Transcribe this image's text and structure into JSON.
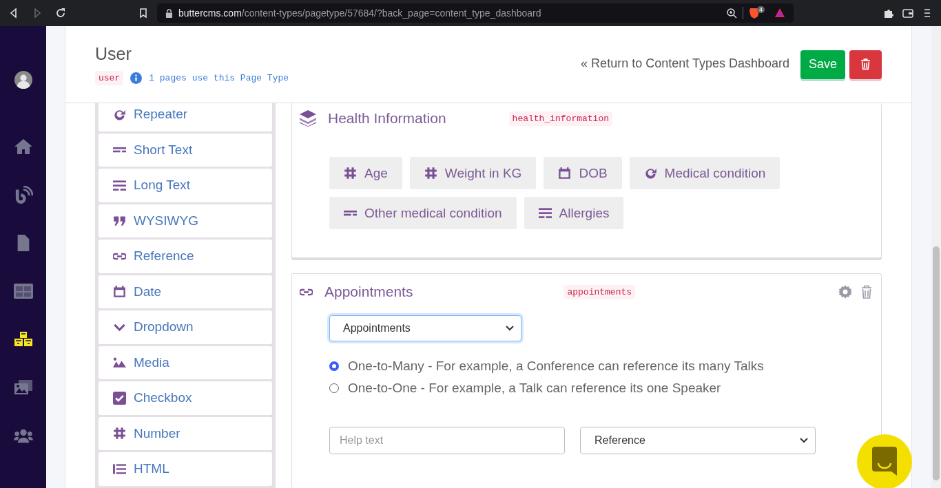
{
  "browser": {
    "url_host": "buttercms.com",
    "url_path": "/content-types/pagetype/57684/?back_page=content_type_dashboard",
    "shield_count": "4",
    "forward_disabled": true
  },
  "nav": {
    "items": [
      {
        "kind": "avatar",
        "selected": false
      },
      {
        "kind": "home",
        "selected": false
      },
      {
        "kind": "blog",
        "selected": false
      },
      {
        "kind": "pages",
        "selected": false
      },
      {
        "kind": "collections",
        "selected": false
      },
      {
        "kind": "content_types",
        "selected": true
      },
      {
        "kind": "media",
        "selected": false
      },
      {
        "kind": "users",
        "selected": false
      }
    ]
  },
  "header": {
    "title": "User",
    "slug": "user",
    "usage": "1 pages use this Page Type",
    "return_link": "« Return to Content Types Dashboard",
    "save": "Save"
  },
  "palette": [
    {
      "kind": "repeater",
      "label": "Repeater"
    },
    {
      "kind": "short_text",
      "label": "Short Text"
    },
    {
      "kind": "long_text",
      "label": "Long Text"
    },
    {
      "kind": "wysiwyg",
      "label": "WYSIWYG"
    },
    {
      "kind": "reference",
      "label": "Reference"
    },
    {
      "kind": "date",
      "label": "Date"
    },
    {
      "kind": "dropdown",
      "label": "Dropdown"
    },
    {
      "kind": "media",
      "label": "Media"
    },
    {
      "kind": "checkbox",
      "label": "Checkbox"
    },
    {
      "kind": "number",
      "label": "Number"
    },
    {
      "kind": "html",
      "label": "HTML"
    }
  ],
  "sections": [
    {
      "kind": "component",
      "title": "Health Information",
      "slug": "health_information",
      "fields": [
        {
          "kind": "number",
          "label": "Age"
        },
        {
          "kind": "number",
          "label": "Weight in KG"
        },
        {
          "kind": "date",
          "label": "DOB"
        },
        {
          "kind": "repeater",
          "label": "Medical condition"
        },
        {
          "kind": "short_text",
          "label": "Other medical condition"
        },
        {
          "kind": "long_text",
          "label": "Allergies"
        }
      ]
    },
    {
      "kind": "reference",
      "title": "Appointments",
      "slug": "appointments",
      "target": "Appointments",
      "relations": [
        {
          "label": "One-to-Many - For example, a Conference can reference its many Talks",
          "selected": true
        },
        {
          "label": "One-to-One - For example, a Talk can reference its one Speaker",
          "selected": false
        }
      ],
      "help_placeholder": "Help text",
      "field_type": "Reference"
    }
  ]
}
